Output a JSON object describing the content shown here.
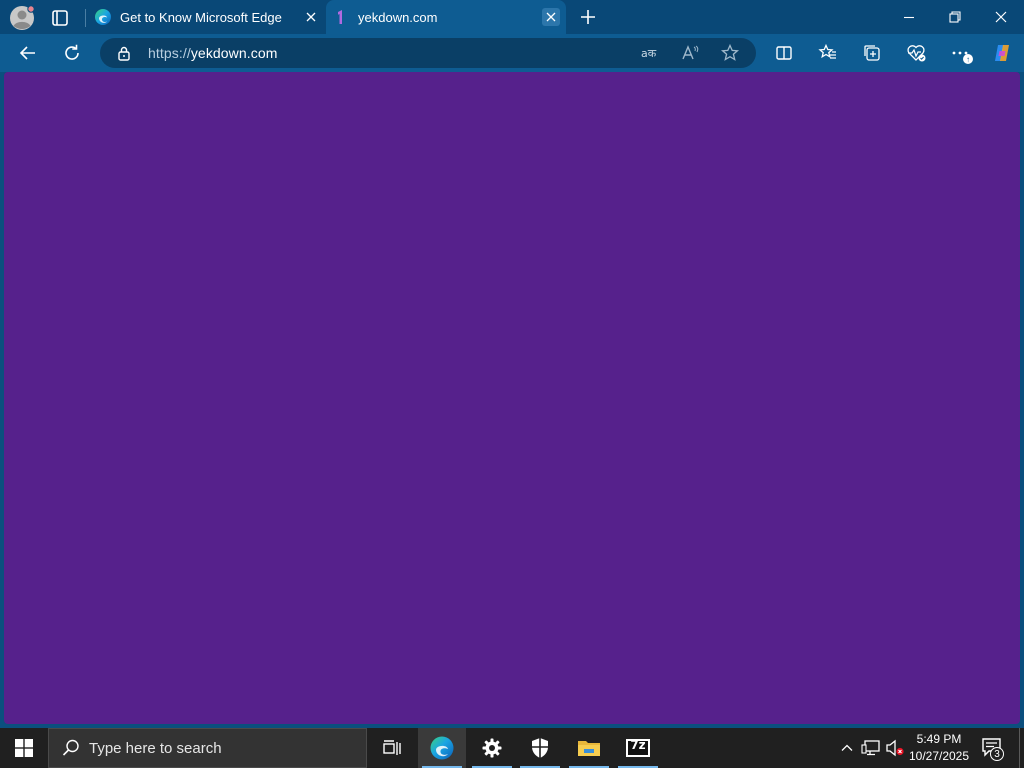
{
  "browser": {
    "tabs": [
      {
        "title": "Get to Know Microsoft Edge",
        "favicon": "edge-icon",
        "active": false
      },
      {
        "title": "yekdown.com",
        "favicon": "yekdown-favicon",
        "active": true
      }
    ],
    "address": {
      "protocol": "https://",
      "host": "yekdown.com"
    },
    "page_background": "#56218c",
    "chrome_color": "#0e5c92"
  },
  "taskbar": {
    "search_placeholder": "Type here to search",
    "time": "5:49 PM",
    "date": "10/27/2025",
    "notification_count": "3",
    "pinned": [
      "task-view-icon",
      "edge-icon",
      "settings-icon",
      "security-icon",
      "file-explorer-icon",
      "7zip-icon"
    ],
    "sevenzip_label": "7z"
  }
}
